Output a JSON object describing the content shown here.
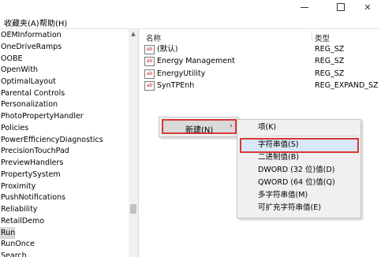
{
  "menubar": {
    "favorites": "收藏夹(A)",
    "help": "帮助(H)"
  },
  "window_controls": {
    "minimize": "minimize",
    "maximize": "maximize",
    "close": "✕"
  },
  "tree": {
    "items": [
      "OEMInformation",
      "OneDriveRamps",
      "OOBE",
      "OpenWith",
      "OptimalLayout",
      "Parental Controls",
      "Personalization",
      "PhotoPropertyHandler",
      "Policies",
      "PowerEfficiencyDiagnostics",
      "PrecisionTouchPad",
      "PreviewHandlers",
      "PropertySystem",
      "Proximity",
      "PushNotifications",
      "Reliability",
      "RetailDemo",
      "Run",
      "RunOnce",
      "Search"
    ],
    "selected": "Run"
  },
  "values_pane": {
    "headers": {
      "name": "名称",
      "type": "类型"
    },
    "rows": [
      {
        "name": "(默认)",
        "type": "REG_SZ"
      },
      {
        "name": "Energy Management",
        "type": "REG_SZ"
      },
      {
        "name": "EnergyUtility",
        "type": "REG_SZ"
      },
      {
        "name": "SynTPEnh",
        "type": "REG_EXPAND_SZ"
      }
    ],
    "value_icon_text": "ab"
  },
  "context_menu": {
    "new_label": "新建(N)",
    "arrow": "›"
  },
  "submenu": {
    "items": [
      "项(K)",
      "字符串值(S)",
      "二进制值(B)",
      "DWORD (32 位)值(D)",
      "QWORD (64 位)值(Q)",
      "多字符串值(M)",
      "可扩充字符串值(E)"
    ],
    "highlighted": "字符串值(S)"
  },
  "colors": {
    "highlight_border": "#d93838",
    "selected_bg": "#d9d9d9",
    "hover_bg": "#d9e8f7"
  }
}
